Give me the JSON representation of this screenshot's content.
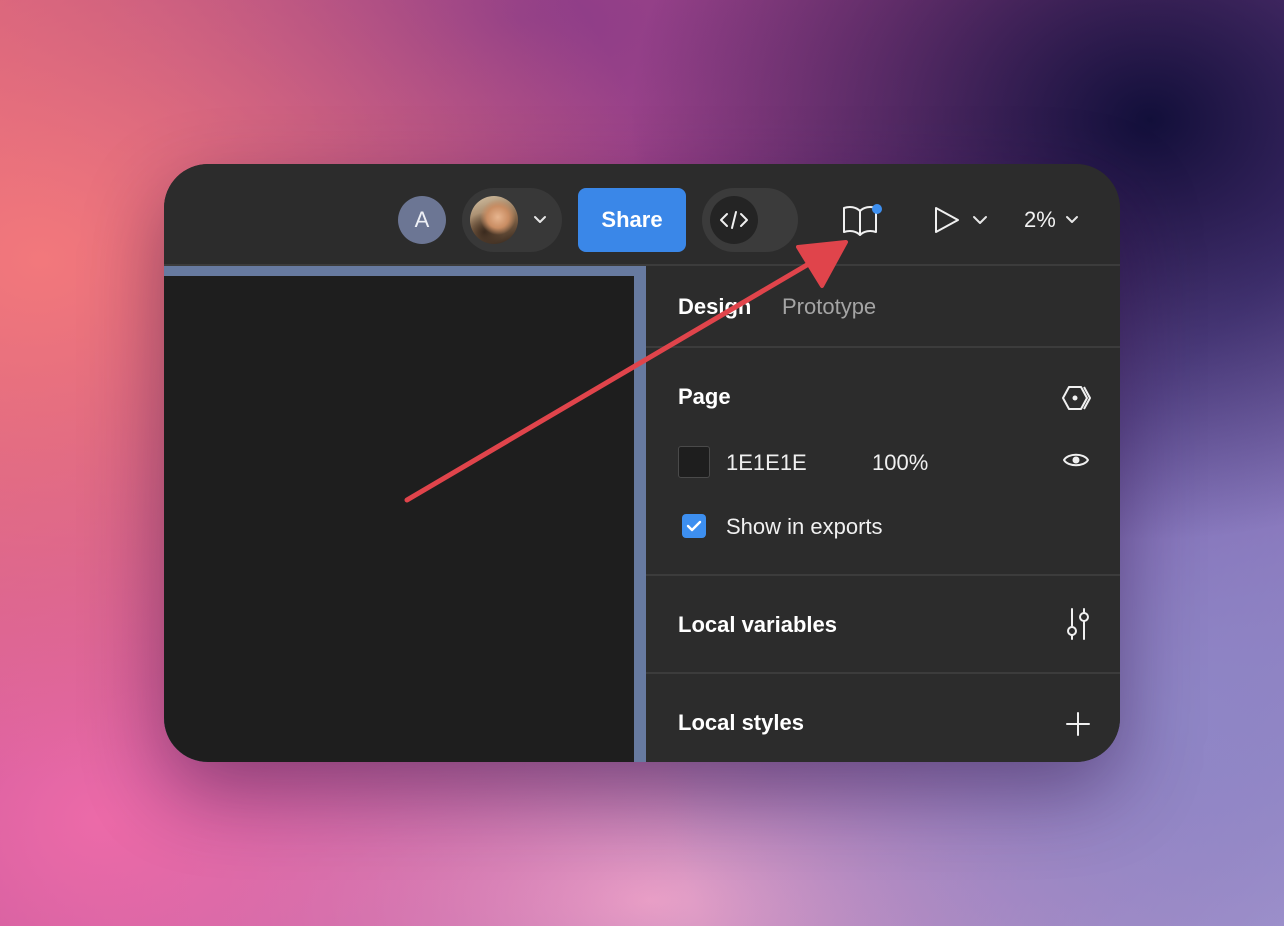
{
  "toolbar": {
    "avatar_initial": "A",
    "share_label": "Share",
    "zoom_label": "2%"
  },
  "panel": {
    "tabs": [
      {
        "label": "Design",
        "active": true
      },
      {
        "label": "Prototype",
        "active": false
      }
    ],
    "page": {
      "title": "Page",
      "background_hex": "1E1E1E",
      "background_opacity": "100%",
      "show_in_exports_label": "Show in exports",
      "show_in_exports_checked": true
    },
    "local_variables_title": "Local variables",
    "local_styles_title": "Local styles"
  },
  "icons": {
    "user_photo": "user-avatar-photo",
    "dev_mode": "code-brackets-icon",
    "library": "book-open-icon",
    "present": "play-icon",
    "page_settings": "hexagon-settings-icon",
    "visibility": "eye-icon",
    "variables": "sliders-icon",
    "add": "plus-icon"
  },
  "colors": {
    "accent": "#3a87e8",
    "window_bg": "#2c2c2c",
    "canvas_frame": "#1e1e1e",
    "annotation_arrow": "#e0444b"
  }
}
